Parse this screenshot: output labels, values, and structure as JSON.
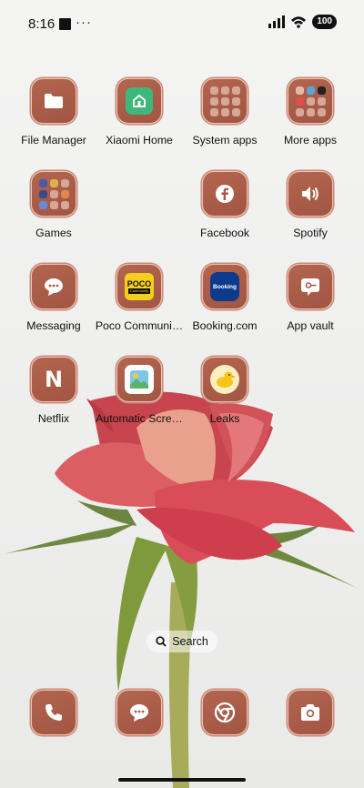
{
  "status": {
    "time": "8:16",
    "dots": "···",
    "battery": "100"
  },
  "apps": {
    "file_manager": "File Manager",
    "xiaomi_home": "Xiaomi Home",
    "system_apps": "System apps",
    "more_apps": "More apps",
    "games": "Games",
    "facebook": "Facebook",
    "spotify": "Spotify",
    "messaging": "Messaging",
    "poco_community": "Poco Communi…",
    "booking": "Booking.com",
    "app_vault": "App vault",
    "netflix": "Netflix",
    "automatic_screen": "Automatic Scre…",
    "leaks": "Leaks"
  },
  "icon_text": {
    "poco": "POCO",
    "poco_sub": "Community",
    "booking": "Booking",
    "netflix": "N"
  },
  "search": {
    "label": "Search"
  },
  "colors": {
    "icon_bg": "#a9594a",
    "rose": "#d85a5e",
    "stem": "#7f9040"
  }
}
